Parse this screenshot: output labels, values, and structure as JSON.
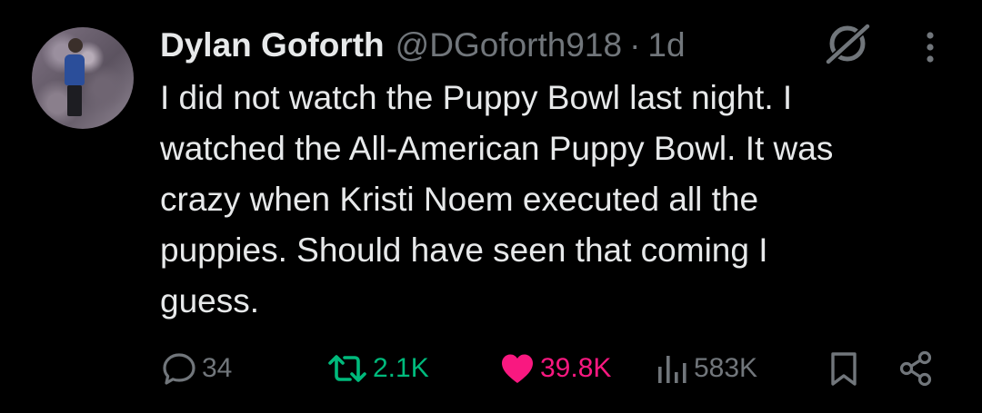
{
  "tweet": {
    "display_name": "Dylan Goforth",
    "handle": "@DGoforth918",
    "separator": "·",
    "time": "1d",
    "text": "I did not watch the Puppy Bowl last night. I\nwatched the All-American Puppy Bowl. It was\ncrazy when Kristi Noem executed all the\npuppies. Should have seen that coming I\nguess."
  },
  "actions": {
    "replies": "34",
    "reposts": "2.1K",
    "likes": "39.8K",
    "views": "583K"
  },
  "icons": {
    "reply": "reply-bubble-icon",
    "repost": "repost-arrows-icon",
    "like": "heart-icon",
    "views": "views-bar-chart-icon",
    "bookmark": "bookmark-icon",
    "share": "share-icon",
    "grok": "grok-slash-circle-icon",
    "more": "more-vertical-dots-icon"
  },
  "colors": {
    "background": "#000000",
    "text_primary": "#e7e9ea",
    "text_secondary": "#71767b",
    "repost_active": "#00ba7c",
    "like_active": "#f91880"
  }
}
